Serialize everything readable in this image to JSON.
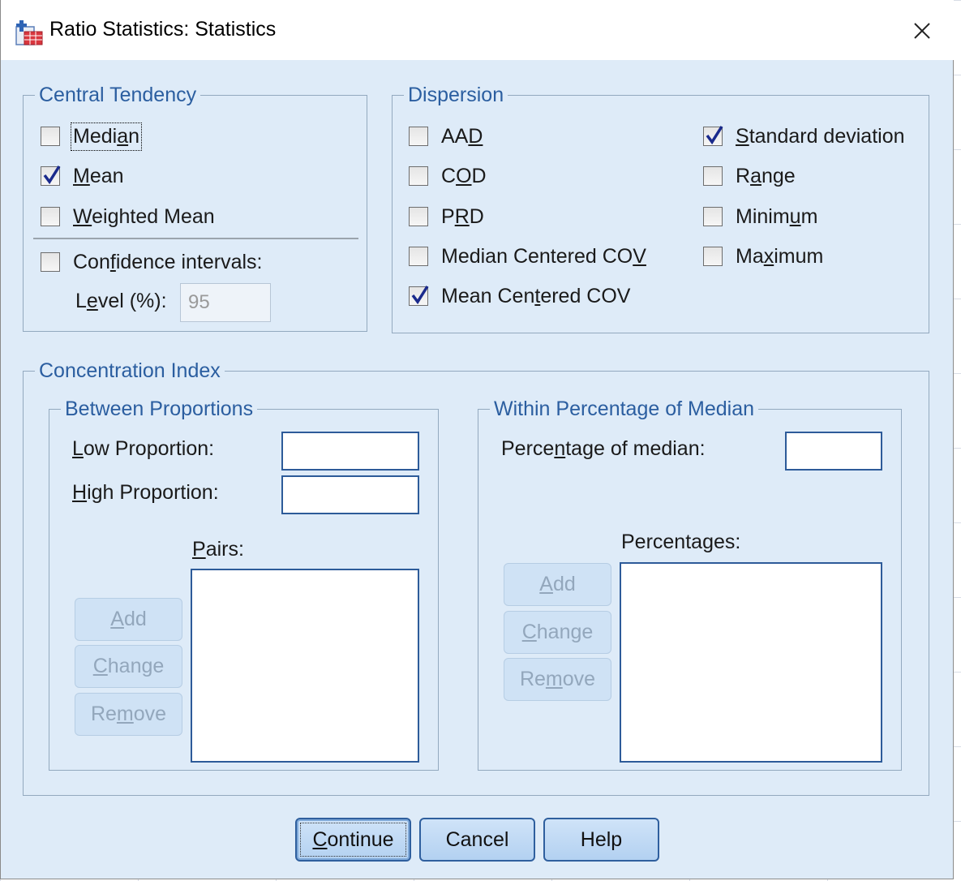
{
  "window": {
    "title": "Ratio Statistics: Statistics"
  },
  "central_tendency": {
    "legend": "Central Tendency",
    "median": {
      "pre": "Medi",
      "key": "a",
      "post": "n",
      "checked": false
    },
    "mean": {
      "pre": "",
      "key": "M",
      "post": "ean",
      "checked": true
    },
    "weighted_mean": {
      "pre": "",
      "key": "W",
      "post": "eighted Mean",
      "checked": false
    },
    "confidence": {
      "pre": "Con",
      "key": "f",
      "post": "idence intervals:",
      "checked": false
    },
    "level_label": {
      "pre": "L",
      "key": "e",
      "post": "vel (%):"
    },
    "level_value": "95"
  },
  "dispersion": {
    "legend": "Dispersion",
    "aad": {
      "pre": "AA",
      "key": "D",
      "post": "",
      "checked": false
    },
    "cod": {
      "pre": "C",
      "key": "O",
      "post": "D",
      "checked": false
    },
    "prd": {
      "pre": "P",
      "key": "R",
      "post": "D",
      "checked": false
    },
    "median_cov": {
      "pre": "Median Centered CO",
      "key": "V",
      "post": "",
      "checked": false
    },
    "mean_cov": {
      "pre": "Mean Cen",
      "key": "t",
      "post": "ered COV",
      "checked": true
    },
    "std": {
      "pre": "",
      "key": "S",
      "post": "tandard deviation",
      "checked": true
    },
    "range": {
      "pre": "R",
      "key": "a",
      "post": "nge",
      "checked": false
    },
    "minimum": {
      "pre": "Minim",
      "key": "u",
      "post": "m",
      "checked": false
    },
    "maximum": {
      "pre": "Ma",
      "key": "x",
      "post": "imum",
      "checked": false
    }
  },
  "concentration": {
    "legend": "Concentration Index",
    "between": {
      "legend": "Between Proportions",
      "low": {
        "pre": "",
        "key": "L",
        "post": "ow Proportion:",
        "value": ""
      },
      "high": {
        "pre": "",
        "key": "H",
        "post": "igh Proportion:",
        "value": ""
      },
      "pairs": {
        "pre": "",
        "key": "P",
        "post": "airs:"
      },
      "add": {
        "pre": "",
        "key": "A",
        "post": "dd"
      },
      "change": {
        "pre": "",
        "key": "C",
        "post": "hange"
      },
      "remove": {
        "pre": "Re",
        "key": "m",
        "post": "ove"
      }
    },
    "within": {
      "legend": "Within Percentage of Median",
      "pct": {
        "pre": "Perce",
        "key": "n",
        "post": "tage of median:",
        "value": ""
      },
      "percentages": {
        "pre": "Percenta",
        "key": "g",
        "post": "es:"
      },
      "add": {
        "pre": "",
        "key": "A",
        "post": "dd"
      },
      "change": {
        "pre": "",
        "key": "C",
        "post": "hange"
      },
      "remove": {
        "pre": "Re",
        "key": "m",
        "post": "ove"
      }
    }
  },
  "footer": {
    "continue": {
      "pre": "",
      "key": "C",
      "post": "ontinue"
    },
    "cancel": "Cancel",
    "help": "Help"
  },
  "colors": {
    "dialog_bg": "#deebf8",
    "legend_text": "#2b5ea0",
    "check_mark": "#1a2a8c",
    "button_border": "#2f5f9e"
  }
}
